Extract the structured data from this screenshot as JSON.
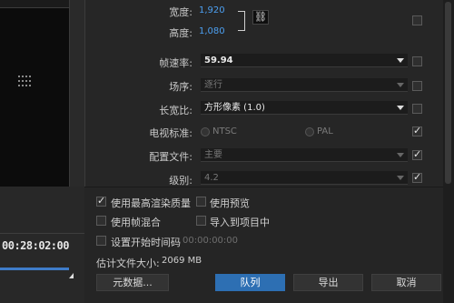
{
  "preview": {
    "timecode": "00:28:02:00",
    "progress_fraction": 1.0
  },
  "video_settings": {
    "width_label": "宽度:",
    "width_value": "1,920",
    "height_label": "高度:",
    "height_value": "1,080",
    "frame_rate_label": "帧速率:",
    "frame_rate_value": "59.94",
    "field_order_label": "场序:",
    "field_order_value": "逐行",
    "aspect_label": "长宽比:",
    "aspect_value": "方形像素 (1.0)",
    "tv_standard_label": "电视标准:",
    "tv_ntsc": "NTSC",
    "tv_pal": "PAL",
    "profile_label": "配置文件:",
    "profile_value": "主要",
    "level_label": "级别:",
    "level_value": "4.2"
  },
  "options": {
    "max_render_quality": "使用最高渲染质量",
    "use_previews": "使用预览",
    "frame_blending": "使用帧混合",
    "import_into_project": "导入到项目中",
    "set_start_timecode": "设置开始时间码",
    "start_timecode_value": "00:00:00:00",
    "estimated_size_label": "估计文件大小:",
    "estimated_size_value": "2069 MB"
  },
  "buttons": {
    "metadata": "元数据...",
    "queue": "队列",
    "export": "导出",
    "cancel": "取消"
  },
  "colors": {
    "accent": "#4c9ff0",
    "primary_button": "#2d6fb3"
  }
}
